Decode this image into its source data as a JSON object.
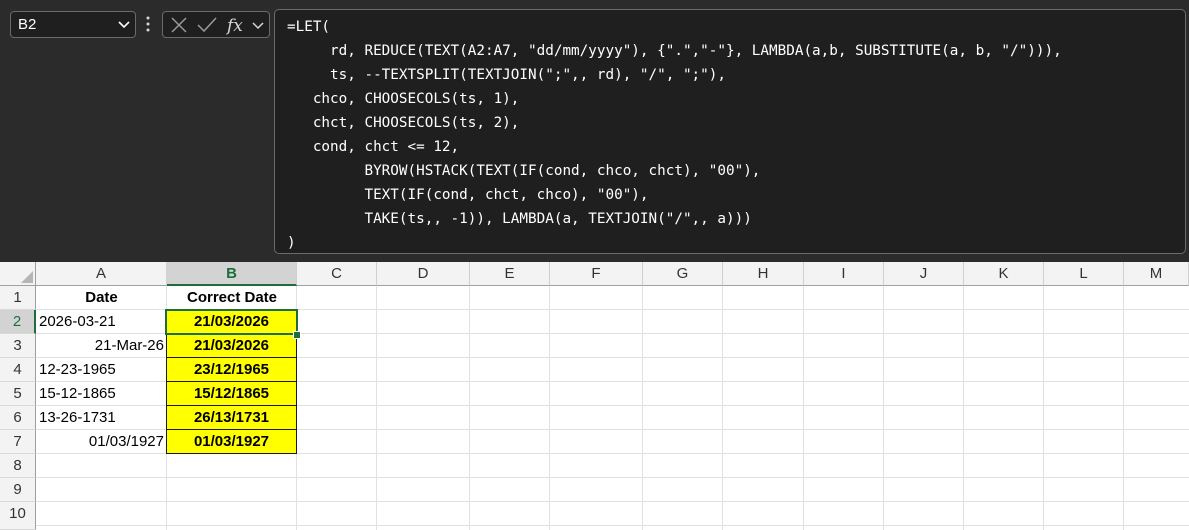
{
  "name_box": {
    "value": "B2"
  },
  "formula_bar": {
    "lines": [
      "=LET(",
      "     rd, REDUCE(TEXT(A2:A7, \"dd/mm/yyyy\"), {\".\",\"-\"}, LAMBDA(a,b, SUBSTITUTE(a, b, \"/\"))),",
      "     ts, --TEXTSPLIT(TEXTJOIN(\";\",, rd), \"/\", \";\"),",
      "   chco, CHOOSECOLS(ts, 1),",
      "   chct, CHOOSECOLS(ts, 2),",
      "   cond, chct <= 12,",
      "         BYROW(HSTACK(TEXT(IF(cond, chco, chct), \"00\"),",
      "         TEXT(IF(cond, chct, chco), \"00\"),",
      "         TAKE(ts,, -1)), LAMBDA(a, TEXTJOIN(\"/\",, a)))",
      ")"
    ]
  },
  "columns": [
    "A",
    "B",
    "C",
    "D",
    "E",
    "F",
    "G",
    "H",
    "I",
    "J",
    "K",
    "L",
    "M"
  ],
  "rows": [
    "1",
    "2",
    "3",
    "4",
    "5",
    "6",
    "7",
    "8",
    "9",
    "10"
  ],
  "cells": {
    "A1": "Date",
    "B1": "Correct Date",
    "A2": "2026-03-21",
    "B2": "21/03/2026",
    "A3": "21-Mar-26",
    "B3": "21/03/2026",
    "A4": "12-23-1965",
    "B4": "23/12/1965",
    "A5": "15-12-1865",
    "B5": "15/12/1865",
    "A6": "13-26-1731",
    "B6": "26/13/1731",
    "A7": "01/03/1927",
    "B7": "01/03/1927"
  },
  "colors": {
    "highlight": "#ffff00",
    "selection": "#1e6e3c",
    "formula_bg": "#1f1f1f"
  },
  "icons": {
    "name_box_dropdown": "chevron-down-icon",
    "more": "vertical-ellipsis-icon",
    "cancel": "x-icon",
    "enter": "check-icon",
    "insert_function": "fx-icon",
    "fx_dropdown": "chevron-down-icon"
  }
}
